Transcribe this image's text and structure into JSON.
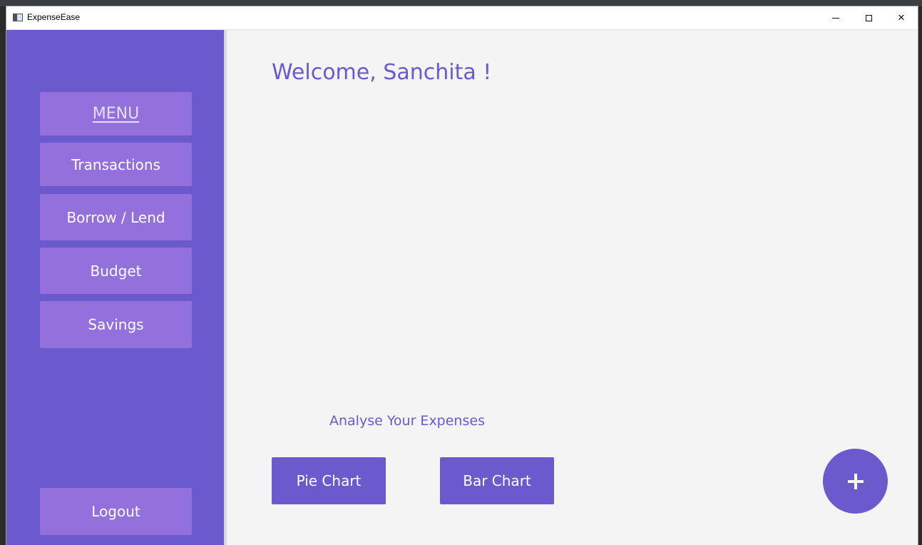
{
  "window": {
    "title": "ExpenseEase",
    "minimize_glyph": "",
    "close_glyph": "✕"
  },
  "sidebar": {
    "menu_title": "MENU",
    "items": [
      {
        "label": "Transactions"
      },
      {
        "label": "Borrow / Lend"
      },
      {
        "label": "Budget"
      },
      {
        "label": "Savings"
      }
    ],
    "logout_label": "Logout"
  },
  "main": {
    "welcome": "Welcome, Sanchita !",
    "analyse_label": "Analyse Your Expenses",
    "pie_chart_label": "Pie Chart",
    "bar_chart_label": "Bar Chart",
    "add_icon": "plus-icon"
  },
  "colors": {
    "sidebar_bg": "#6a5acd",
    "menu_button_bg": "#9370db",
    "accent": "#6a5acd",
    "content_bg": "#f4f4f4"
  }
}
